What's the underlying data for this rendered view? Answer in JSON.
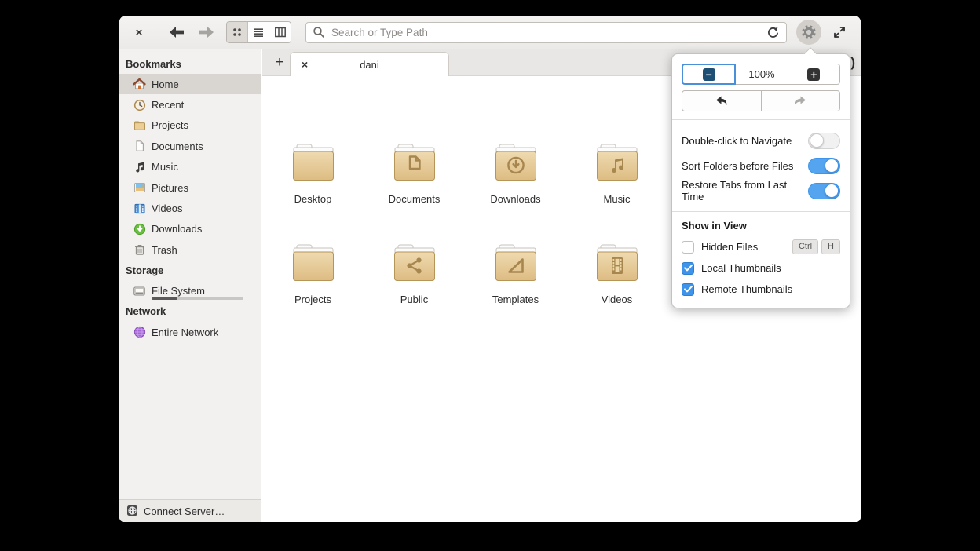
{
  "colors": {
    "accent": "#3d94ea",
    "folder_fill": "#e7cd99",
    "folder_stroke": "#b59558",
    "selection": "#d9d6d2"
  },
  "header": {
    "close_label": "×",
    "search_placeholder": "Search or Type Path",
    "view_modes": [
      {
        "name": "grid",
        "active": true
      },
      {
        "name": "list",
        "active": false
      },
      {
        "name": "column",
        "active": false
      }
    ],
    "back_enabled": true,
    "forward_enabled": false
  },
  "tabbar": {
    "new_tab_label": "+",
    "tabs": [
      {
        "title": "dani",
        "close_label": "×"
      }
    ]
  },
  "sidebar": {
    "sections": [
      {
        "header": "Bookmarks",
        "items": [
          {
            "label": "Home",
            "icon": "home-icon",
            "selected": true
          },
          {
            "label": "Recent",
            "icon": "recent-icon",
            "selected": false
          },
          {
            "label": "Projects",
            "icon": "folder-icon",
            "selected": false
          },
          {
            "label": "Documents",
            "icon": "document-icon",
            "selected": false
          },
          {
            "label": "Music",
            "icon": "music-icon",
            "selected": false
          },
          {
            "label": "Pictures",
            "icon": "pictures-icon",
            "selected": false
          },
          {
            "label": "Videos",
            "icon": "videos-icon",
            "selected": false
          },
          {
            "label": "Downloads",
            "icon": "downloads-icon",
            "selected": false
          },
          {
            "label": "Trash",
            "icon": "trash-icon",
            "selected": false
          }
        ]
      },
      {
        "header": "Storage",
        "items": [
          {
            "label": "File System",
            "icon": "drive-icon",
            "selected": false,
            "usage": 0.28
          }
        ]
      },
      {
        "header": "Network",
        "items": [
          {
            "label": "Entire Network",
            "icon": "network-icon",
            "selected": false
          }
        ]
      }
    ],
    "connect_server": {
      "label": "Connect Server…",
      "icon": "server-icon"
    }
  },
  "files": [
    {
      "name": "Desktop",
      "glyph": "none"
    },
    {
      "name": "Documents",
      "glyph": "document"
    },
    {
      "name": "Downloads",
      "glyph": "download"
    },
    {
      "name": "Music",
      "glyph": "music"
    },
    {
      "name": "Projects",
      "glyph": "none"
    },
    {
      "name": "Public",
      "glyph": "share"
    },
    {
      "name": "Templates",
      "glyph": "template"
    },
    {
      "name": "Videos",
      "glyph": "film"
    }
  ],
  "popover": {
    "zoom": {
      "out_label": "−",
      "level": "100%",
      "in_label": "+"
    },
    "back_enabled": true,
    "forward_enabled": false,
    "toggles": [
      {
        "label": "Double-click to Navigate",
        "on": false
      },
      {
        "label": "Sort Folders before Files",
        "on": true
      },
      {
        "label": "Restore Tabs from Last Time",
        "on": true
      }
    ],
    "section_header": "Show in View",
    "checks": [
      {
        "label": "Hidden Files",
        "checked": false,
        "shortcut": [
          "Ctrl",
          "H"
        ]
      },
      {
        "label": "Local Thumbnails",
        "checked": true,
        "shortcut": []
      },
      {
        "label": "Remote Thumbnails",
        "checked": true,
        "shortcut": []
      }
    ]
  }
}
